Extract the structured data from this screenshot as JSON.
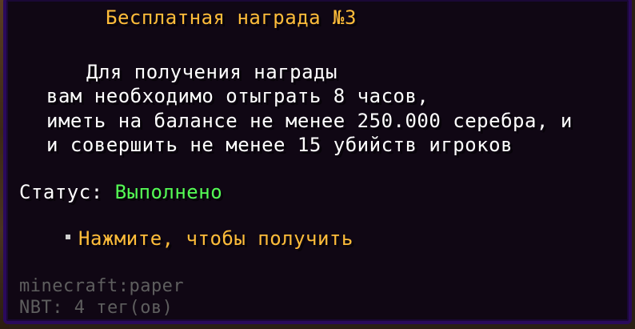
{
  "tooltip": {
    "title": "Бесплатная награда №3",
    "description": [
      "Для получения награды",
      "вам необходимо отыграть 8 часов,",
      "иметь на балансе не менее 250.000 серебра, и",
      "и совершить не менее 15 убийств игроков"
    ],
    "status_label": "Статус: ",
    "status_value": "Выполнено",
    "action": "Нажмите, чтобы получить",
    "item_id": "minecraft:paper",
    "nbt": "NBT: 4 тег(ов)"
  },
  "colors": {
    "title": "#ffbd3a",
    "status_done": "#55ff55",
    "text": "#ffffff",
    "meta": "#5e5e5e",
    "border": "#2a0a5c",
    "background": "#100714"
  }
}
